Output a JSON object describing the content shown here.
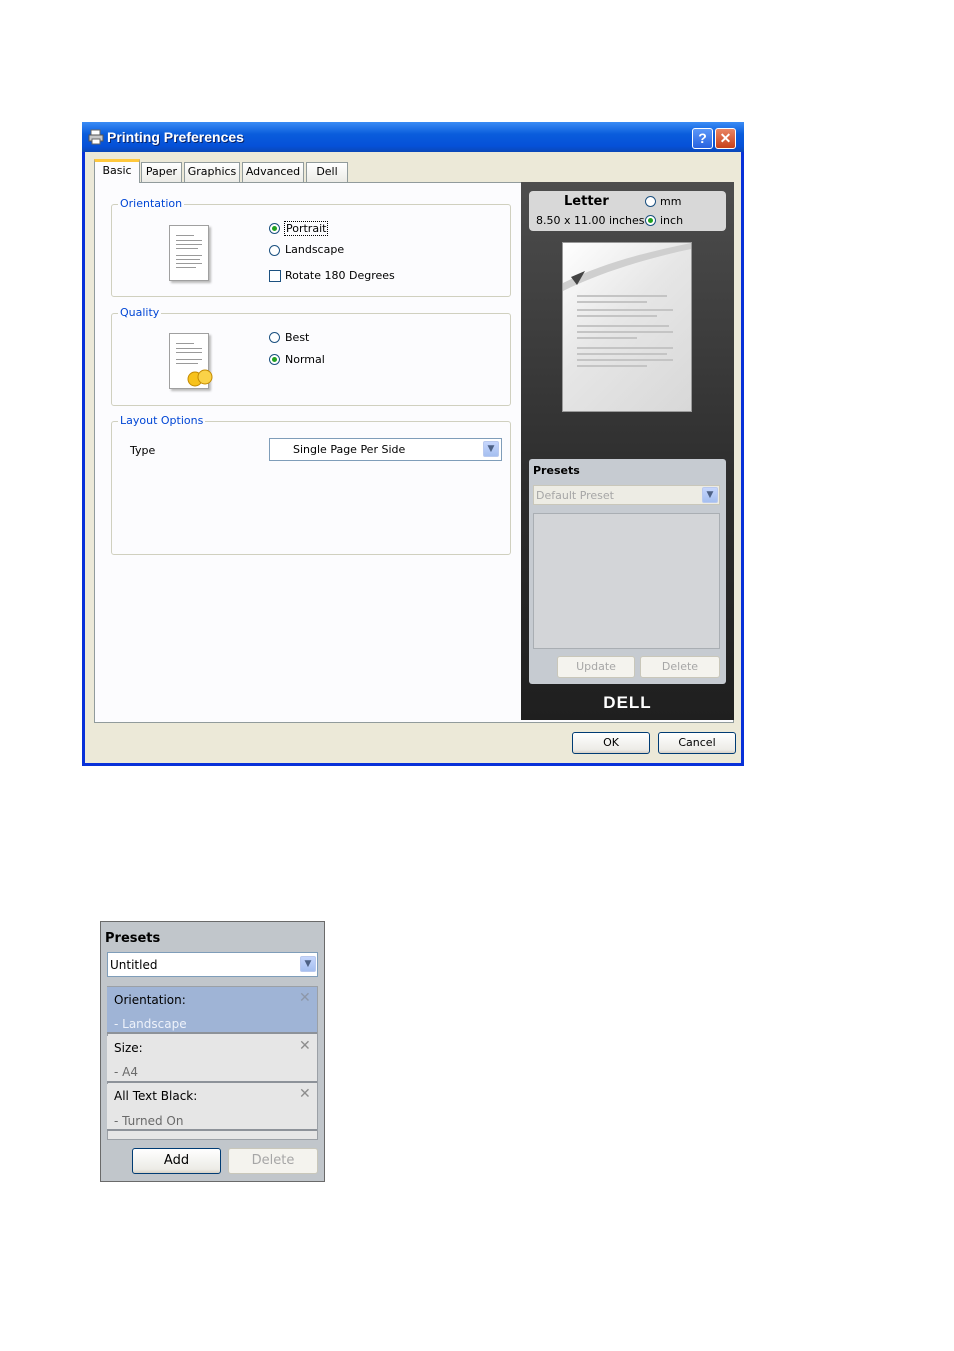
{
  "dialog": {
    "title": "Printing Preferences",
    "help_label": "?",
    "close_label": "✕",
    "tabs": [
      {
        "label": "Basic"
      },
      {
        "label": "Paper"
      },
      {
        "label": "Graphics"
      },
      {
        "label": "Advanced"
      },
      {
        "label": "Dell"
      }
    ],
    "orientation": {
      "group_label": "Orientation",
      "options": [
        {
          "label": "Portrait",
          "checked": true
        },
        {
          "label": "Landscape",
          "checked": false
        }
      ],
      "rotate_label": "Rotate 180 Degrees"
    },
    "quality": {
      "group_label": "Quality",
      "options": [
        {
          "label": "Best",
          "checked": false
        },
        {
          "label": "Normal",
          "checked": true
        }
      ]
    },
    "layout": {
      "group_label": "Layout Options",
      "type_label": "Type",
      "type_value": "Single Page Per Side"
    },
    "paper": {
      "name": "Letter",
      "size": "8.50 x 11.00 inches",
      "unit_mm": "mm",
      "unit_inch": "inch"
    },
    "presets": {
      "heading": "Presets",
      "selected": "Default Preset",
      "update_label": "Update",
      "delete_label": "Delete"
    },
    "brand": "DELL",
    "ok_label": "OK",
    "cancel_label": "Cancel"
  },
  "presets_panel": {
    "heading": "Presets",
    "selected": "Untitled",
    "items": [
      {
        "name": "Orientation:",
        "value": "- Landscape",
        "selected": true
      },
      {
        "name": "Size:",
        "value": "- A4",
        "selected": false
      },
      {
        "name": "All Text Black:",
        "value": "- Turned On",
        "selected": false
      }
    ],
    "add_label": "Add",
    "delete_label": "Delete"
  },
  "colors": {
    "title_blue": "#0a5ddc",
    "group_label_blue": "#0046d5",
    "selected_item": "#9fb4d6"
  }
}
